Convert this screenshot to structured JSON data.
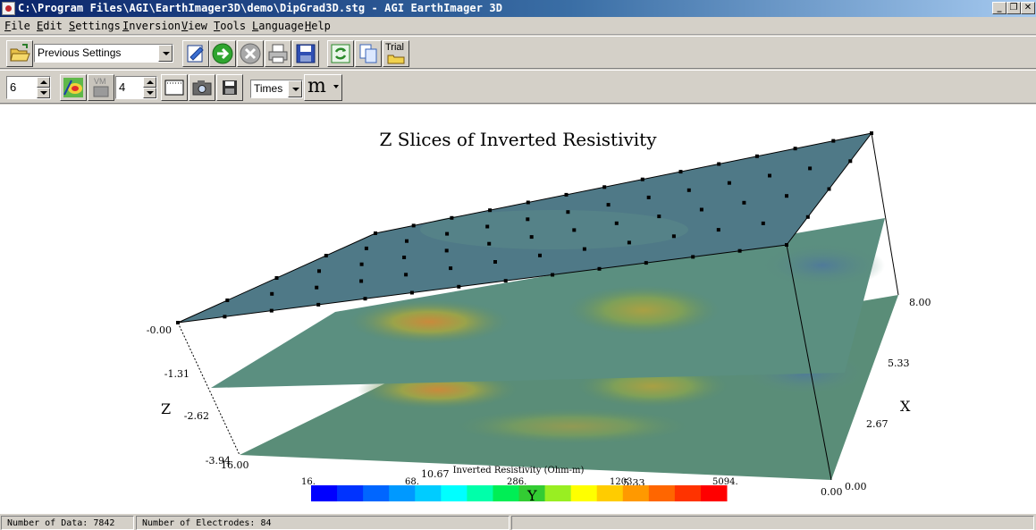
{
  "window": {
    "title": "C:\\Program Files\\AGI\\EarthImager3D\\demo\\DipGrad3D.stg - AGI EarthImager 3D",
    "controls": {
      "minimize": "_",
      "restore": "❐",
      "close": "✕"
    }
  },
  "menu": [
    {
      "mnemonic": "F",
      "rest": "ile"
    },
    {
      "mnemonic": "E",
      "rest": "dit"
    },
    {
      "mnemonic": "S",
      "rest": "ettings"
    },
    {
      "mnemonic": "I",
      "rest": "nversion"
    },
    {
      "mnemonic": "V",
      "rest": "iew"
    },
    {
      "mnemonic": "T",
      "rest": "ools"
    },
    {
      "mnemonic": "L",
      "rest": "anguage"
    },
    {
      "mnemonic": "H",
      "rest": "elp"
    }
  ],
  "toolbar1": {
    "settings_combo": "Previous Settings",
    "trial_label": "Trial",
    "icons": [
      "open-folder-icon",
      "edit-settings-icon",
      "run-arrow-icon",
      "stop-icon",
      "print-icon",
      "save-disk-icon",
      "refresh-icon",
      "copy-icon",
      "trial-folder-icon"
    ]
  },
  "toolbar2": {
    "slice_count": "6",
    "vm_label": "VM",
    "contour_count": "4",
    "font_combo": "Times",
    "font_size_glyph": "m"
  },
  "plot": {
    "title": "Z Slices of Inverted Resistivity",
    "z_axis": {
      "label": "Z",
      "ticks": [
        "-0.00",
        "-1.31",
        "-2.62",
        "-3.94"
      ]
    },
    "x_axis": {
      "label": "X",
      "ticks": [
        "8.00",
        "5.33",
        "2.67",
        "0.00"
      ]
    },
    "y_axis": {
      "label": "Y",
      "ticks": [
        "16.00",
        "10.67",
        "5.33",
        "0.00"
      ]
    },
    "colorbar": {
      "title": "Inverted Resistivity (Ohm-m)",
      "tick_labels": [
        "16.",
        "68.",
        "286.",
        "1203.",
        "5094."
      ],
      "colors": [
        "#0000ff",
        "#0033ff",
        "#0066ff",
        "#0099ff",
        "#00ccff",
        "#00ffff",
        "#00ffaa",
        "#00ee55",
        "#33cc33",
        "#99ee22",
        "#ffff00",
        "#ffcc00",
        "#ff9900",
        "#ff6600",
        "#ff3300",
        "#ff0000"
      ]
    }
  },
  "status": {
    "data_count": "Number of Data: 7842",
    "electrode_count": "Number of Electrodes: 84"
  }
}
